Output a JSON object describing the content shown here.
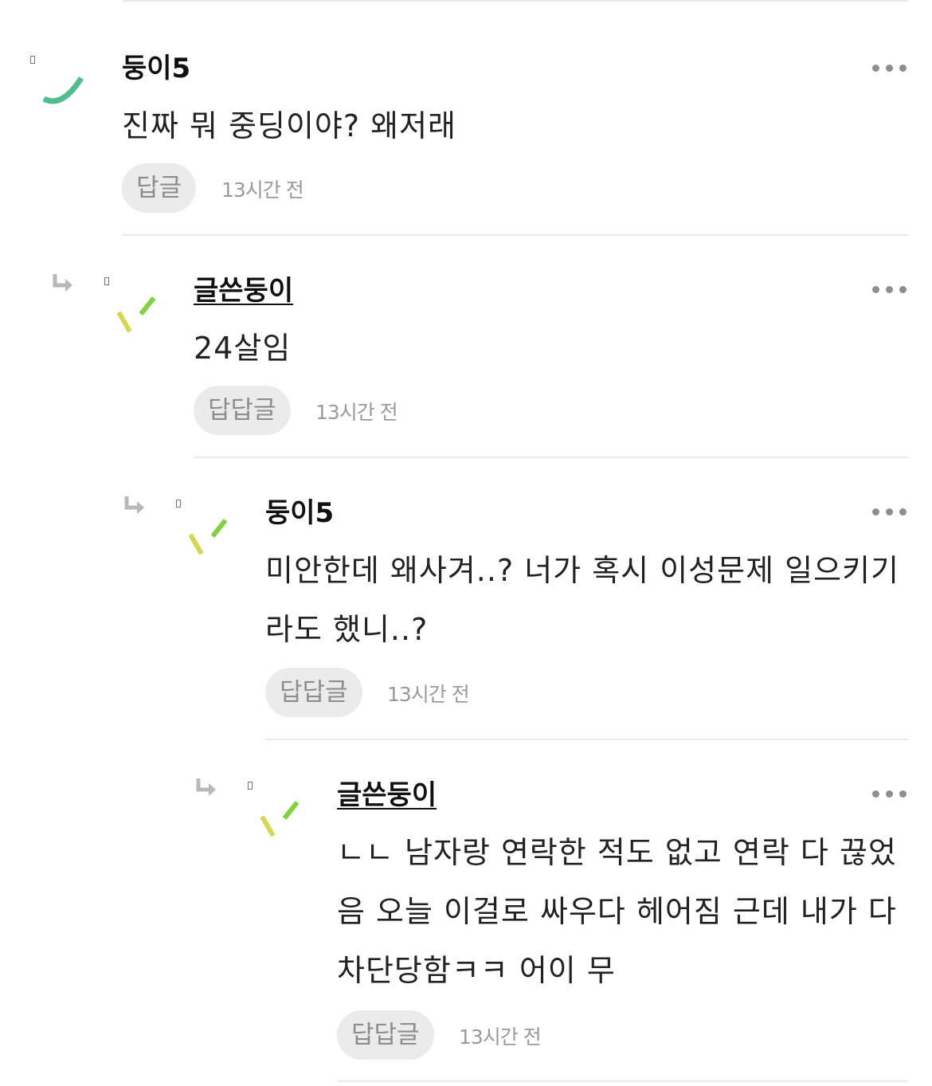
{
  "comments": [
    {
      "author": "둥이5",
      "text": "진짜 뭐 중딩이야? 왜저래",
      "reply_label": "답글",
      "time": "13시간 전"
    },
    {
      "author": "글쓴둥이",
      "text": "24살임",
      "reply_label": "답답글",
      "time": "13시간 전"
    },
    {
      "author": "둥이5",
      "text": "미안한데 왜사겨..? 너가 혹시 이성문제 일으키기라도 했니..?",
      "reply_label": "답답글",
      "time": "13시간 전"
    },
    {
      "author": "글쓴둥이",
      "text": "ㄴㄴ 남자랑 연락한 적도 없고 연락 다 끊었음 오늘 이걸로 싸우다 헤어짐 근데 내가 다 차단당함ㅋㅋ 어이 무",
      "reply_label": "답답글",
      "time": "13시간 전"
    }
  ],
  "icons": {
    "more": "more-dots-icon",
    "reply_arrow": "reply-arrow-icon",
    "avatar": "avatar-placeholder-icon"
  },
  "colors": {
    "avatar_green_dark": "#4cbf8a",
    "avatar_green": "#7ed43a",
    "avatar_yellow": "#d4d84a"
  }
}
